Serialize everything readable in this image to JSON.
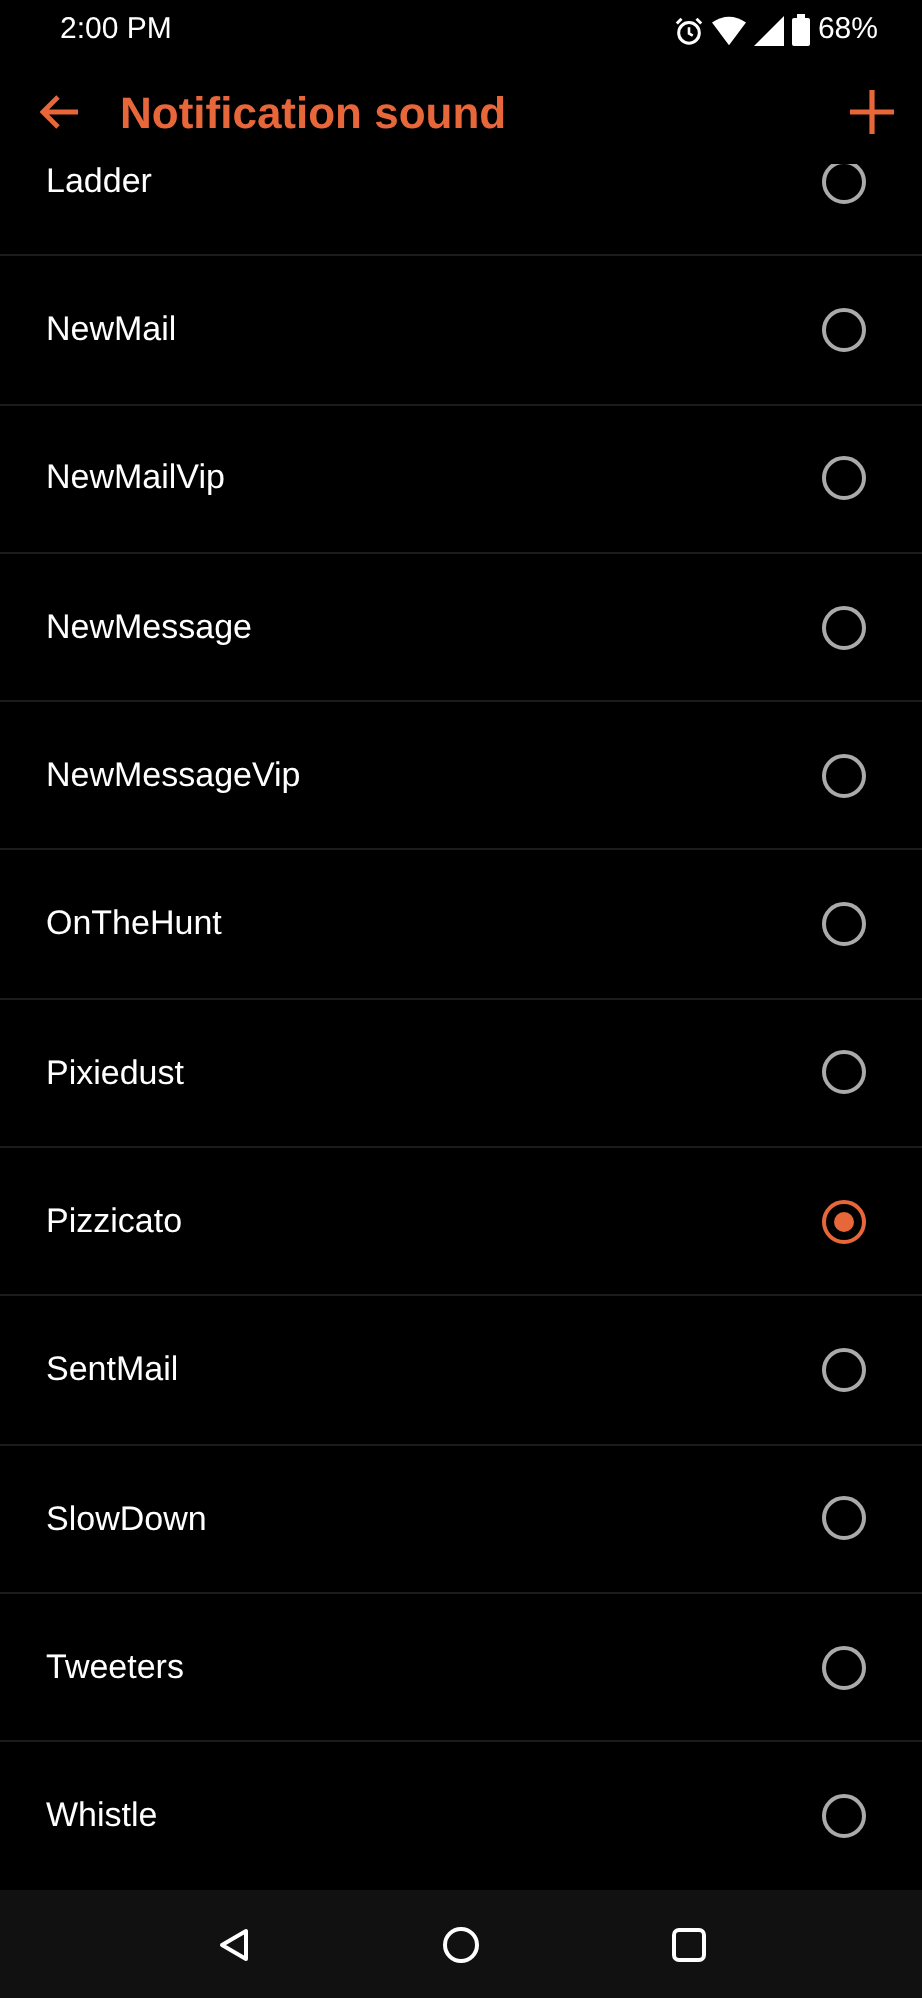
{
  "status_bar": {
    "time": "2:00 PM",
    "battery": "68%"
  },
  "header": {
    "title": "Notification sound"
  },
  "sounds": [
    {
      "label": "Ladder",
      "selected": false
    },
    {
      "label": "NewMail",
      "selected": false
    },
    {
      "label": "NewMailVip",
      "selected": false
    },
    {
      "label": "NewMessage",
      "selected": false
    },
    {
      "label": "NewMessageVip",
      "selected": false
    },
    {
      "label": "OnTheHunt",
      "selected": false
    },
    {
      "label": "Pixiedust",
      "selected": false
    },
    {
      "label": "Pizzicato",
      "selected": true
    },
    {
      "label": "SentMail",
      "selected": false
    },
    {
      "label": "SlowDown",
      "selected": false
    },
    {
      "label": "Tweeters",
      "selected": false
    },
    {
      "label": "Whistle",
      "selected": false
    }
  ]
}
